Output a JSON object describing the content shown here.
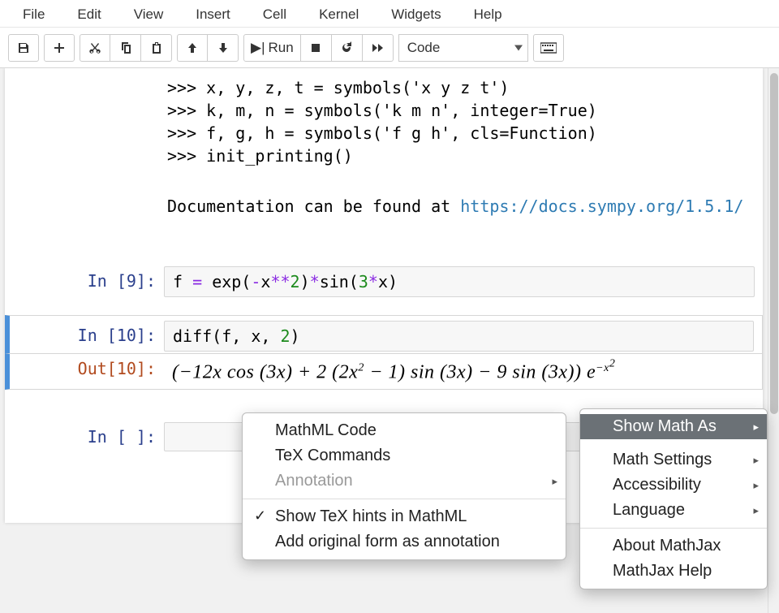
{
  "menubar": [
    "File",
    "Edit",
    "View",
    "Insert",
    "Cell",
    "Kernel",
    "Widgets",
    "Help"
  ],
  "toolbar": {
    "celltype": "Code",
    "run_label": "Run"
  },
  "intro": {
    "lines": [
      ">>> x, y, z, t = symbols('x y z t')",
      ">>> k, m, n = symbols('k m n', integer=True)",
      ">>> f, g, h = symbols('f g h', cls=Function)",
      ">>> init_printing()"
    ],
    "doc_label": "Documentation can be found at ",
    "doc_url": "https://docs.sympy.org/1.5.1/"
  },
  "cells": {
    "c1": {
      "prompt": "In [9]:",
      "tokens": {
        "t0": "f ",
        "t1": "= ",
        "t2": "exp(",
        "t3": "-",
        "t4": "x",
        "t5": "**",
        "t6": "2",
        "t7": ")",
        "t8": "*",
        "t9": "sin(",
        "t10": "3",
        "t11": "*",
        "t12": "x",
        "t13": ")"
      }
    },
    "c2": {
      "prompt": "In [10]:",
      "tokens": {
        "t0": "diff(f, x, ",
        "t1": "2",
        "t2": ")"
      }
    },
    "out2": {
      "prompt": "Out[10]:",
      "math": "(−12x cos (3x) + 2 (2x² − 1) sin (3x) − 9 sin (3x)) e⁻ˣ²"
    },
    "c3": {
      "prompt": "In [ ]:"
    }
  },
  "mathjax_menu": {
    "main": [
      {
        "label": "Show Math As",
        "hl": true,
        "sub": true
      },
      {
        "label": "Math Settings",
        "sub": true
      },
      {
        "label": "Accessibility",
        "sub": true
      },
      {
        "label": "Language",
        "sub": true
      },
      {
        "sep": true
      },
      {
        "label": "About MathJax"
      },
      {
        "label": "MathJax Help"
      }
    ],
    "sub": [
      {
        "label": "MathML Code"
      },
      {
        "label": "TeX Commands"
      },
      {
        "label": "Annotation",
        "disabled": true,
        "sub": true
      },
      {
        "sep": true
      },
      {
        "label": "Show TeX hints in MathML",
        "check": true
      },
      {
        "label": "Add original form as annotation"
      }
    ]
  }
}
